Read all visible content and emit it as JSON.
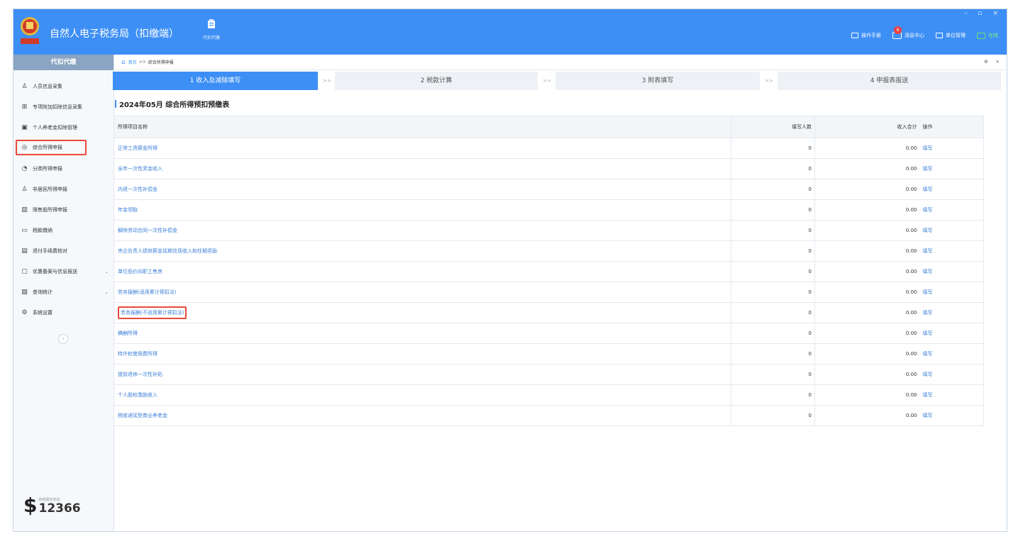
{
  "header": {
    "app_title": "自然人电子税务局（扣缴端）",
    "nav_label": "代扣代缴",
    "window_controls": "– ▫ ×",
    "links": [
      {
        "icon": "manual-icon",
        "label": "操作手册"
      },
      {
        "icon": "message-icon",
        "label": "消息中心",
        "badge": "6"
      },
      {
        "icon": "unit-icon",
        "label": "单位管理"
      },
      {
        "icon": "online-icon",
        "label": "在线"
      }
    ]
  },
  "sidebar": {
    "title": "代扣代缴",
    "items": [
      {
        "icon": "user-icon",
        "glyph": "♙",
        "label": "人员信息采集"
      },
      {
        "icon": "grid-icon",
        "glyph": "⊞",
        "label": "专项附加扣除信息采集"
      },
      {
        "icon": "pension-icon",
        "glyph": "▣",
        "label": "个人养老金扣除管理"
      },
      {
        "icon": "comprehensive-income-icon",
        "glyph": "◎",
        "label": "综合所得申报",
        "active": true
      },
      {
        "icon": "classified-income-icon",
        "glyph": "◔",
        "label": "分类所得申报"
      },
      {
        "icon": "nonresident-icon",
        "glyph": "♙",
        "label": "非居民所得申报"
      },
      {
        "icon": "restricted-shares-icon",
        "glyph": "▥",
        "label": "限售股所得申报"
      },
      {
        "icon": "tax-payment-icon",
        "glyph": "▭",
        "label": "税款缴纳"
      },
      {
        "icon": "refund-check-icon",
        "glyph": "▤",
        "label": "退付手续费核对"
      },
      {
        "icon": "preferential-icon",
        "glyph": "▢",
        "label": "优惠备案与信息报送",
        "chevron": true
      },
      {
        "icon": "query-stats-icon",
        "glyph": "▧",
        "label": "查询统计",
        "chevron": true
      },
      {
        "icon": "settings-icon",
        "glyph": "⚙",
        "label": "系统设置"
      }
    ],
    "collapse": "‹",
    "hotline_caption": "纳税服务热线",
    "hotline_number": "12366"
  },
  "breadcrumb": {
    "home": "首页",
    "sep": ">>",
    "current": "综合所得申报",
    "controls": "⊕ ×"
  },
  "steps": [
    {
      "label": "1 收入及减除填写",
      "active": true
    },
    {
      "label": "2 税款计算"
    },
    {
      "label": "3 附表填写"
    },
    {
      "label": "4 申报表报送"
    }
  ],
  "step_sep": ">>",
  "table": {
    "title": "2024年05月  综合所得预扣预缴表",
    "columns": {
      "name": "所得项目名称",
      "count": "填写人数",
      "total": "收入合计",
      "op": "操作"
    },
    "rows": [
      {
        "name": "正常工资薪金所得",
        "count": "0",
        "total": "0.00",
        "op": "填写"
      },
      {
        "name": "全年一次性奖金收入",
        "count": "0",
        "total": "0.00",
        "op": "填写"
      },
      {
        "name": "内退一次性补偿金",
        "count": "0",
        "total": "0.00",
        "op": "填写"
      },
      {
        "name": "年金领取",
        "count": "0",
        "total": "0.00",
        "op": "填写"
      },
      {
        "name": "解除劳动合同一次性补偿金",
        "count": "0",
        "total": "0.00",
        "op": "填写"
      },
      {
        "name": "央企负责人绩效薪金延期兑现收入和任期奖励",
        "count": "0",
        "total": "0.00",
        "op": "填写"
      },
      {
        "name": "单位低价向职工售房",
        "count": "0",
        "total": "0.00",
        "op": "填写"
      },
      {
        "name": "劳务报酬(适用累计预扣法)",
        "count": "0",
        "total": "0.00",
        "op": "填写"
      },
      {
        "name": "劳务报酬(不适用累计预扣法)",
        "count": "0",
        "total": "0.00",
        "op": "填写",
        "highlight": true
      },
      {
        "name": "稿酬所得",
        "count": "0",
        "total": "0.00",
        "op": "填写"
      },
      {
        "name": "特许权使用费所得",
        "count": "0",
        "total": "0.00",
        "op": "填写"
      },
      {
        "name": "提前退休一次性补贴",
        "count": "0",
        "total": "0.00",
        "op": "填写"
      },
      {
        "name": "个人股权激励收入",
        "count": "0",
        "total": "0.00",
        "op": "填写"
      },
      {
        "name": "税收递延型商业养老金",
        "count": "0",
        "total": "0.00",
        "op": "填写"
      }
    ]
  },
  "colors": {
    "primary": "#3d8ff5",
    "highlight": "#e84a3a",
    "link": "#3a7fd8"
  }
}
